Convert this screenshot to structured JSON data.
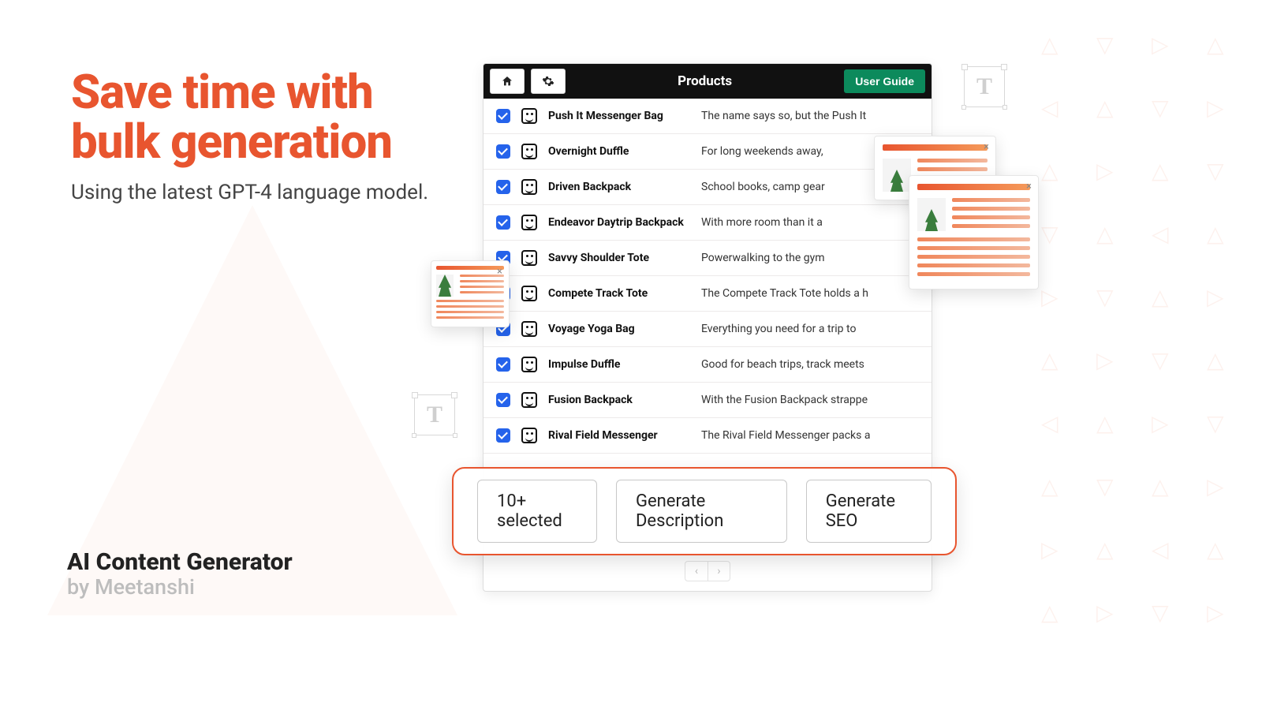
{
  "hero": {
    "title_line1": "Save time with",
    "title_line2": "bulk generation",
    "subtitle": "Using the latest GPT-4 language model."
  },
  "brand": {
    "name": "AI Content Generator",
    "by": "by Meetanshi"
  },
  "toolbar": {
    "title": "Products",
    "guide_label": "User Guide"
  },
  "products": [
    {
      "name": "Push It Messenger Bag",
      "desc": "The name says so, but the Push It"
    },
    {
      "name": "Overnight Duffle",
      "desc": "For long weekends away,"
    },
    {
      "name": "Driven Backpack",
      "desc": "School books, camp gear"
    },
    {
      "name": "Endeavor Daytrip Backpack",
      "desc": "With more room than it a"
    },
    {
      "name": "Savvy Shoulder Tote",
      "desc": "Powerwalking to the gym"
    },
    {
      "name": "Compete Track Tote",
      "desc": "The Compete Track Tote holds a h"
    },
    {
      "name": "Voyage Yoga Bag",
      "desc": "Everything you need for a trip to"
    },
    {
      "name": "Impulse Duffle",
      "desc": "Good for beach trips, track meets"
    },
    {
      "name": "Fusion Backpack",
      "desc": "With the Fusion Backpack strappe"
    },
    {
      "name": "Rival Field Messenger",
      "desc": "The Rival Field Messenger packs a"
    }
  ],
  "popover": {
    "selected_label": "10+ selected",
    "gen_desc_label": "Generate Description",
    "gen_seo_label": "Generate SEO"
  },
  "pager": {
    "prev": "‹",
    "next": "›"
  }
}
